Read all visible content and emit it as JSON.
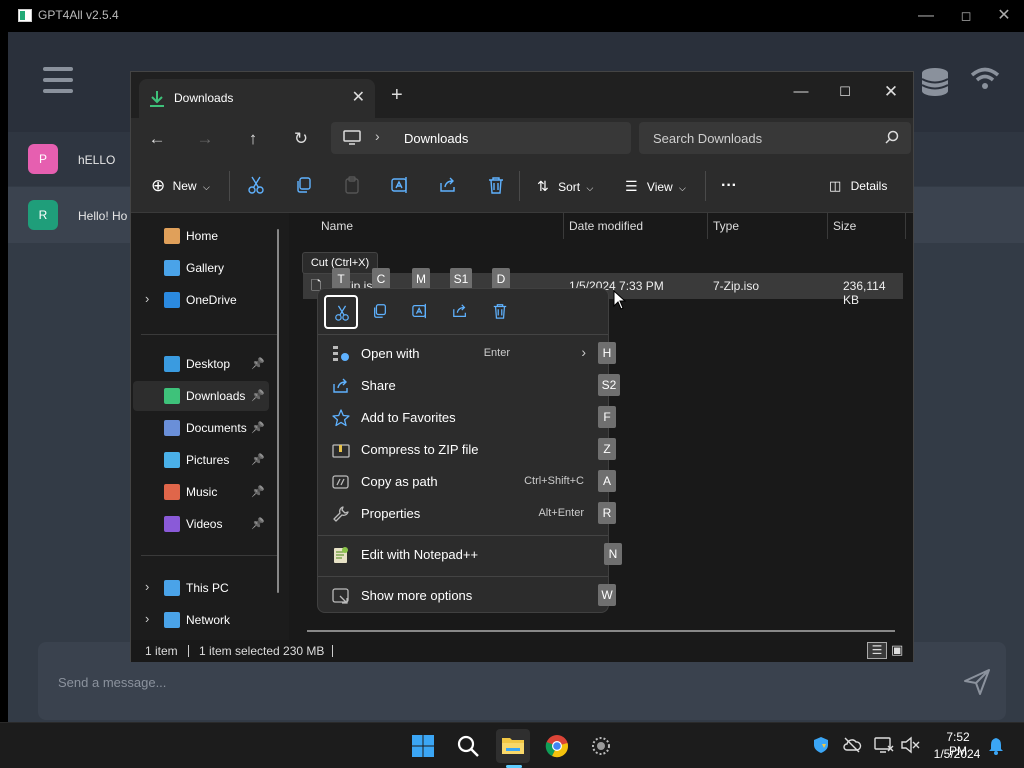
{
  "gpt4all": {
    "title": "GPT4All v2.5.4",
    "user_avatar": "P",
    "user_message": "hELLO",
    "bot_avatar": "R",
    "bot_message": "Hello! Ho",
    "input_placeholder": "Send a message...",
    "colors": {
      "user_avatar": "#e65fb0",
      "bot_avatar": "#1f9e7a"
    }
  },
  "explorer": {
    "tab_title": "Downloads",
    "address": {
      "location": "Downloads"
    },
    "search_placeholder": "Search Downloads",
    "toolbar": {
      "new_label": "New",
      "sort_label": "Sort",
      "view_label": "View",
      "details_label": "Details"
    },
    "nav": [
      {
        "label": "Home",
        "icon": "home-icon",
        "pinned": false,
        "expandable": false
      },
      {
        "label": "Gallery",
        "icon": "gallery-icon",
        "pinned": false,
        "expandable": false
      },
      {
        "label": "OneDrive",
        "icon": "onedrive-icon",
        "pinned": false,
        "expandable": true
      },
      {
        "label": "Desktop",
        "icon": "desktop-icon",
        "pinned": true,
        "expandable": false
      },
      {
        "label": "Downloads",
        "icon": "downloads-icon",
        "pinned": true,
        "expandable": false,
        "selected": true
      },
      {
        "label": "Documents",
        "icon": "documents-icon",
        "pinned": true,
        "expandable": false
      },
      {
        "label": "Pictures",
        "icon": "pictures-icon",
        "pinned": true,
        "expandable": false
      },
      {
        "label": "Music",
        "icon": "music-icon",
        "pinned": true,
        "expandable": false
      },
      {
        "label": "Videos",
        "icon": "videos-icon",
        "pinned": true,
        "expandable": false
      },
      {
        "label": "This PC",
        "icon": "this-pc-icon",
        "pinned": false,
        "expandable": true
      },
      {
        "label": "Network",
        "icon": "network-icon",
        "pinned": false,
        "expandable": true
      }
    ],
    "columns": {
      "name": "Name",
      "date": "Date modified",
      "type": "Type",
      "size": "Size"
    },
    "file": {
      "name": "7-Zip.iso",
      "date": "1/5/2024 7:33 PM",
      "type": "7-Zip.iso",
      "size": "236,114 KB"
    },
    "status": {
      "count": "1 item",
      "selection": "1 item selected 230 MB"
    }
  },
  "tooltip": "Cut (Ctrl+X)",
  "keytips_top": [
    "T",
    "C",
    "M",
    "S1",
    "D"
  ],
  "context_menu": {
    "items": [
      {
        "label": "Open with",
        "shortcut": "Enter",
        "keytip": "H",
        "submenu": true,
        "icon": "open-with-icon"
      },
      {
        "label": "Share",
        "shortcut": "",
        "keytip": "S2",
        "icon": "share-icon"
      },
      {
        "label": "Add to Favorites",
        "shortcut": "",
        "keytip": "F",
        "icon": "star-icon"
      },
      {
        "label": "Compress to ZIP file",
        "shortcut": "",
        "keytip": "Z",
        "icon": "zip-icon"
      },
      {
        "label": "Copy as path",
        "shortcut": "Ctrl+Shift+C",
        "keytip": "A",
        "icon": "copy-path-icon"
      },
      {
        "label": "Properties",
        "shortcut": "Alt+Enter",
        "keytip": "R",
        "icon": "wrench-icon"
      },
      {
        "label": "Edit with Notepad++",
        "shortcut": "",
        "keytip": "N",
        "icon": "notepadpp-icon"
      },
      {
        "label": "Show more options",
        "shortcut": "",
        "keytip": "W",
        "icon": "more-options-icon"
      }
    ]
  },
  "taskbar": {
    "time": "7:52 PM",
    "date": "1/5/2024",
    "apps": [
      "windows-start-icon",
      "search-icon",
      "file-explorer-icon",
      "chrome-icon",
      "gpt4all-icon"
    ]
  }
}
